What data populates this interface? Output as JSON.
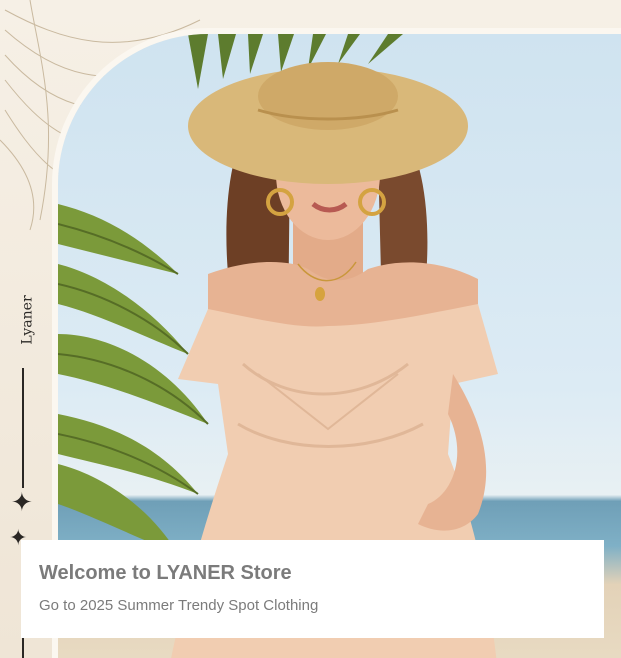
{
  "brand": {
    "side_label": "Lyaner"
  },
  "banner": {
    "title": "Welcome to LYANER Store",
    "subtitle": "Go to 2025 Summer Trendy Spot Clothing"
  },
  "colors": {
    "frame_background": "#f3ece0",
    "sky": "#cfe3f0",
    "sea": "#7fb0c6",
    "dress": "#f1cdb1",
    "hat": "#d9b879",
    "hair": "#7a4a2e",
    "skin": "#e7b393",
    "palm": "#6f8a3a",
    "banner_bg": "#ffffff",
    "banner_text": "#7b7b7b"
  },
  "icons": {
    "sparkle": "four-point-star-icon"
  }
}
